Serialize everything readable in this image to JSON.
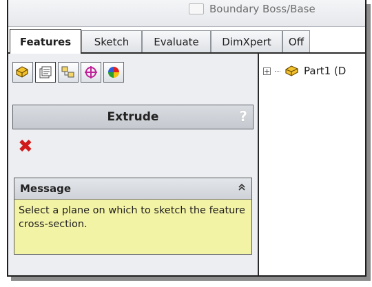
{
  "ribbon": {
    "command_label": "Boundary Boss/Base"
  },
  "tabs": [
    {
      "label": "Features"
    },
    {
      "label": "Sketch"
    },
    {
      "label": "Evaluate"
    },
    {
      "label": "DimXpert"
    },
    {
      "label": "Off"
    }
  ],
  "panel_tabs": [
    {
      "icon": "feature-manager-icon"
    },
    {
      "icon": "property-manager-icon"
    },
    {
      "icon": "configuration-manager-icon"
    },
    {
      "icon": "dimxpert-manager-icon"
    },
    {
      "icon": "display-manager-icon"
    }
  ],
  "property_manager": {
    "title": "Extrude",
    "help_label": "?",
    "cancel_glyph": "✖"
  },
  "message": {
    "header": "Message",
    "collapse_glyph": "≈",
    "text": "Select a plane on which to sketch the feature cross-section."
  },
  "tree": {
    "expander": "+",
    "item_label": "Part1 (D"
  }
}
